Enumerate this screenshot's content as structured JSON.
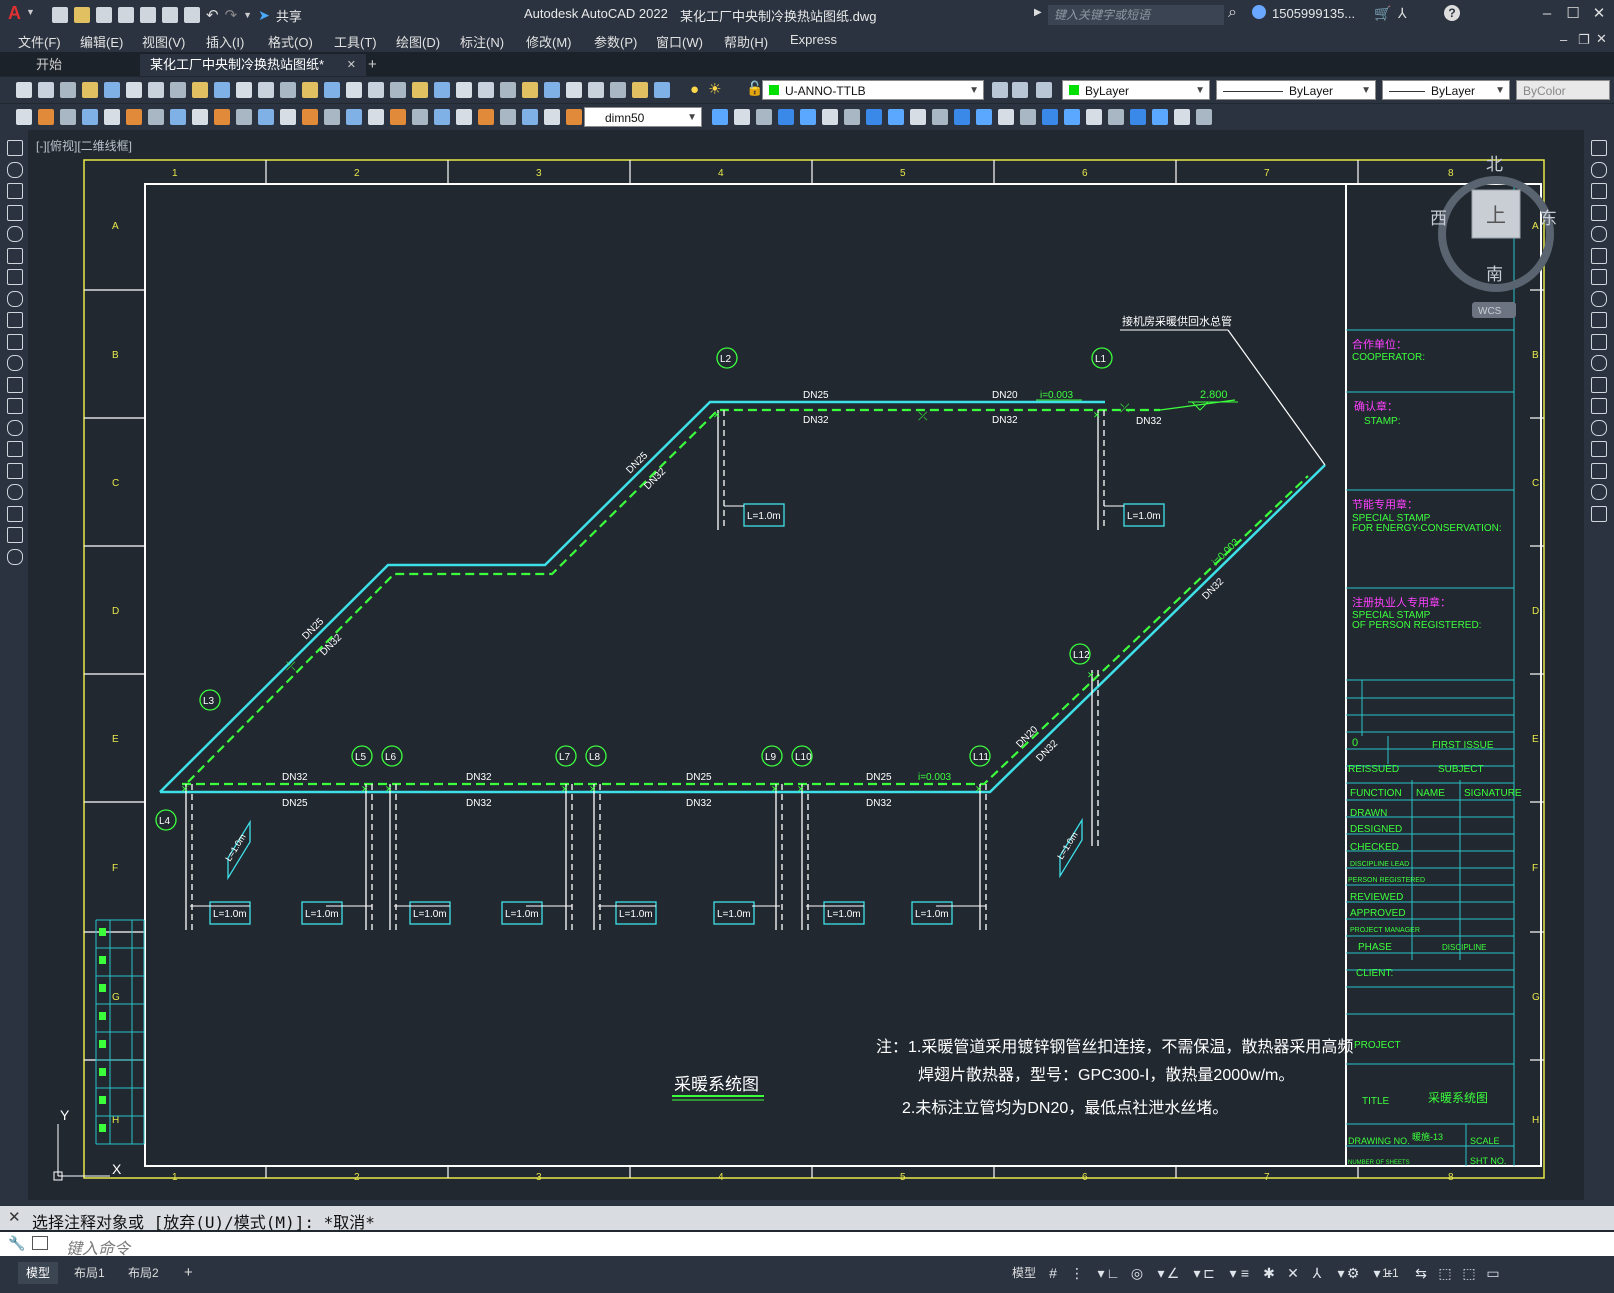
{
  "titlebar": {
    "app_title": "Autodesk AutoCAD 2022",
    "file_title": "某化工厂中央制冷换热站图纸.dwg",
    "share": "共享",
    "search_placeholder": "键入关键字或短语",
    "user": "1505999135...",
    "help": "?"
  },
  "menus": [
    "文件(F)",
    "编辑(E)",
    "视图(V)",
    "插入(I)",
    "格式(O)",
    "工具(T)",
    "绘图(D)",
    "标注(N)",
    "修改(M)",
    "参数(P)",
    "窗口(W)",
    "帮助(H)",
    "Express"
  ],
  "tabs": {
    "start": "开始",
    "active": "某化工厂中央制冷换热站图纸*",
    "close": "✕",
    "add": "+"
  },
  "toolbar": {
    "layer": "U-ANNO-TTLB",
    "color": "ByLayer",
    "linetype": "ByLayer",
    "lineweight": "ByLayer",
    "plotstyle": "ByColor",
    "dimstyle": "dimn50"
  },
  "viewport_label": "[-][俯视][二维线框]",
  "viewcube": {
    "north": "北",
    "south": "南",
    "east": "东",
    "west": "西",
    "top": "上",
    "wcs": "WCS"
  },
  "border": {
    "cols": [
      "1",
      "2",
      "3",
      "4",
      "5",
      "6",
      "7",
      "8"
    ],
    "rows": [
      "A",
      "B",
      "C",
      "D",
      "E",
      "F",
      "G",
      "H"
    ]
  },
  "drawing": {
    "title": "采暖系统图",
    "main_note": "接机房采暖供回水总管",
    "elev": "2.800",
    "notes": [
      "注：1.采暖管道采用镀锌钢管丝扣连接，不需保温，散热器采用高频",
      "焊翅片散热器，型号：GPC300-Ⅰ，散热量2000w/m。",
      "2.未标注立管均为DN20，最低点社泄水丝堵。"
    ],
    "risers": [
      "L1",
      "L2",
      "L3",
      "L4",
      "L5",
      "L6",
      "L7",
      "L8",
      "L9",
      "L10",
      "L11",
      "L12"
    ],
    "radiator_label": "L=1.0m",
    "slope": "i=0.003",
    "pipe_labels": {
      "dn25": "DN25",
      "dn32": "DN32",
      "dn20": "DN20"
    }
  },
  "titleblock": {
    "cooperator_cn": "合作单位：",
    "cooperator_en": "COOPERATOR:",
    "stamp_cn": "确认章：",
    "stamp_en": "STAMP:",
    "energy_cn": "节能专用章：",
    "energy_en1": "SPECIAL STAMP",
    "energy_en2": "FOR ENERGY-CONSERVATION:",
    "person_cn": "注册执业人专用章：",
    "person_en1": "SPECIAL STAMP",
    "person_en2": "OF PERSON REGISTERED:",
    "rev": "0",
    "first_issue": "FIRST ISSUE",
    "reissued": "REISSUED",
    "subject": "SUBJECT",
    "function": "FUNCTION",
    "name": "NAME",
    "signature": "SIGNATURE",
    "drawn": "DRAWN",
    "designed": "DESIGNED",
    "checked": "CHECKED",
    "discipline_lead": "DISCIPLINE LEAD",
    "person_registered": "PERSON REGISTERED",
    "reviewed": "REVIEWED",
    "approved": "APPROVED",
    "project_manager": "PROJECT MANAGER",
    "phase": "PHASE",
    "discipline": "DISCIPLINE",
    "client": "CLIENT:",
    "project": "PROJECT",
    "title_label": "TITLE",
    "title_value": "采暖系统图",
    "drawing_no_label": "DRAWING NO.",
    "drawing_no": "暖施-13",
    "scale": "SCALE",
    "sheets": "NUMBER OF SHEETS",
    "sht_no": "SHT NO."
  },
  "ucs": {
    "y": "Y",
    "x": "X"
  },
  "command": {
    "history": "选择注释对象或 [放弃(U)/模式(M)]: *取消*",
    "placeholder": "键入命令"
  },
  "status": {
    "tabs": [
      "模型",
      "布局1",
      "布局2"
    ],
    "add": "+",
    "model": "模型",
    "scale": "1:1"
  },
  "colors": {
    "cyan": "#3ee0e8",
    "green": "#3cff3c",
    "white": "#ffffff",
    "yellow": "#e8e84a",
    "magenta": "#ff40ff",
    "teal": "#27c2c8"
  }
}
